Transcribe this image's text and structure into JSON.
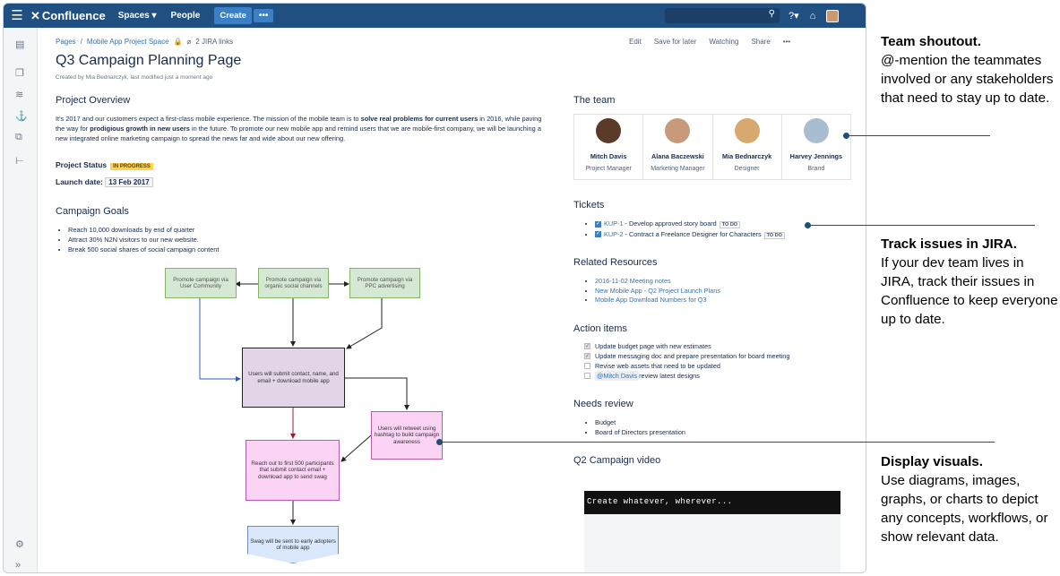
{
  "nav": {
    "logo": "Confluence",
    "spaces": "Spaces ▾",
    "people": "People",
    "create": "Create",
    "more": "•••"
  },
  "breadcrumb": {
    "pages": "Pages",
    "space": "Mobile App Project Space",
    "jira": "2 JIRA links"
  },
  "page_actions": {
    "edit": "Edit",
    "save": "Save for later",
    "watch": "Watching",
    "share": "Share",
    "more": "•••"
  },
  "page": {
    "title": "Q3 Campaign Planning Page",
    "byline": "Created by Mia Bednarczyk, last modified just a moment ago"
  },
  "overview": {
    "heading": "Project Overview",
    "p1": "It's 2017 and our customers expect a first-class mobile experience. The mission of the mobile team is to ",
    "b1": "solve real problems for current users",
    "p2": " in 2016, while paving the way for ",
    "b2": "prodigious growth in new users",
    "p3": " in the future. To promote our new mobile app and remind users that we are mobile-first company, we will be launching a new integrated online marketing campaign to spread the news far and wide about our new offering."
  },
  "status": {
    "label": "Project Status",
    "value": "IN PROGRESS",
    "launch_label": "Launch date:",
    "launch_value": "13 Feb 2017"
  },
  "goals": {
    "heading": "Campaign Goals",
    "items": [
      "Reach 10,000 downloads by end of quarter",
      "Attract 30% N2N visitors to our new website.",
      "Break 500 social shares of social campaign content"
    ]
  },
  "diagram": {
    "g1": "Promote campaign via User Community",
    "g2": "Promote campaign via organic social channels",
    "g3": "Promote campaign via PPC advertising",
    "center": "Users will submit contact, name, and email + download mobile app",
    "retweet": "Users will retweet using hashtag to build campaign awareness",
    "reach": "Reach out to first 500 participants that submit contact email + download app to send swag",
    "swag": "Swag will be sent to early adopters of mobile app"
  },
  "team": {
    "heading": "The team",
    "members": [
      {
        "name": "Mitch Davis",
        "role": "Project Manager"
      },
      {
        "name": "Alana Baczewski",
        "role": "Marketing Manager"
      },
      {
        "name": "Mia Bednarczyk",
        "role": "Designer"
      },
      {
        "name": "Harvey Jennings",
        "role": "Brand"
      }
    ]
  },
  "tickets": {
    "heading": "Tickets",
    "items": [
      {
        "key": "KUP-1",
        "text": " - Develop approved story board",
        "status": "TO DO"
      },
      {
        "key": "KUP-2",
        "text": " - Contract a Freelance Designer for Characters",
        "status": "TO DO"
      }
    ]
  },
  "resources": {
    "heading": "Related Resources",
    "items": [
      "2016-11-02 Meeting notes",
      "New Mobile App - Q2 Project Launch Plans",
      "Mobile App Download Numbers for Q3"
    ]
  },
  "actions": {
    "heading": "Action items",
    "items": [
      "Update budget page with new estimates",
      "Update messaging doc and prepare presentation for board meeting",
      "Revise web assets that need to be updated"
    ],
    "mention": "@Mitch Davis",
    "mention_rest": " review latest designs"
  },
  "review": {
    "heading": "Needs review",
    "items": [
      "Budget",
      "Board of Directors presentation"
    ]
  },
  "video": {
    "heading": "Q2 Campaign video",
    "text": "Create whatever, wherever..."
  },
  "callouts": [
    {
      "title": "Team shoutout.",
      "body": "@-mention the teammates involved or any stakeholders that need to stay up to date."
    },
    {
      "title": "Track issues in JIRA.",
      "body": "If your dev team lives in JIRA, track their issues in Confluence to keep everyone up to date."
    },
    {
      "title": "Display visuals.",
      "body": "Use diagrams, images, graphs, or charts to depict any concepts, workflows, or show relevant data."
    }
  ]
}
